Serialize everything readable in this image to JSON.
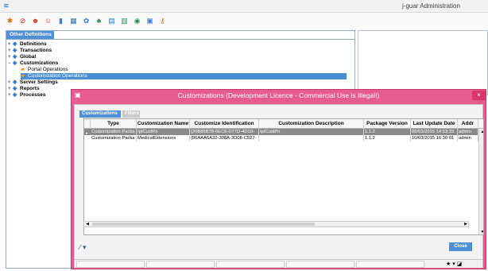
{
  "window": {
    "title": "j-guar Administration",
    "app_icon": "app-logo-icon"
  },
  "toolbar": {
    "buttons": [
      {
        "name": "refresh-icon",
        "glyph": "✱",
        "color": "#c87a10"
      },
      {
        "name": "stop-icon",
        "glyph": "⊘",
        "color": "#d21f1f"
      },
      {
        "name": "users-icon",
        "glyph": "☻",
        "color": "#d4401e"
      },
      {
        "name": "user-icon",
        "glyph": "☺",
        "color": "#d4401e"
      },
      {
        "name": "chart-icon",
        "glyph": "▮",
        "color": "#3a7bd5"
      },
      {
        "name": "calculator-icon",
        "glyph": "▦",
        "color": "#3a6fa0"
      },
      {
        "name": "settings-icon",
        "glyph": "✿",
        "color": "#3a7bd5"
      },
      {
        "name": "network-icon",
        "glyph": "♣",
        "color": "#2e8b57"
      },
      {
        "name": "id-card-icon",
        "glyph": "▤",
        "color": "#2a7cc4"
      },
      {
        "name": "reports-icon",
        "glyph": "▥",
        "color": "#2e8b57"
      },
      {
        "name": "database-icon",
        "glyph": "◉",
        "color": "#2e8b57"
      },
      {
        "name": "monitor-icon",
        "glyph": "▣",
        "color": "#3a7bd5"
      },
      {
        "name": "key-icon",
        "glyph": "⚷",
        "color": "#c87a10"
      }
    ]
  },
  "left_panel": {
    "tab_label": "Other Definitions",
    "tree": [
      {
        "label": "Definitions",
        "level": 0,
        "bold": true,
        "expander": "+"
      },
      {
        "label": "Transactions",
        "level": 0,
        "bold": true,
        "expander": "+"
      },
      {
        "label": "Global",
        "level": 0,
        "bold": true,
        "expander": "+"
      },
      {
        "label": "Customizations",
        "level": 0,
        "bold": true,
        "expander": "−"
      },
      {
        "label": "Portal Operations",
        "level": 1,
        "bold": false,
        "expander": ""
      },
      {
        "label": "Customization Operations",
        "level": 1,
        "bold": false,
        "expander": "",
        "selected": true
      },
      {
        "label": "Server Settings",
        "level": 0,
        "bold": true,
        "expander": "+"
      },
      {
        "label": "Reports",
        "level": 0,
        "bold": true,
        "expander": "+"
      },
      {
        "label": "Processes",
        "level": 0,
        "bold": true,
        "expander": "+"
      }
    ]
  },
  "dialog": {
    "title": "Customizations (Development Licence - Commercial Use is Illegal!)",
    "close_glyph": "×",
    "tabs": [
      {
        "label": "Customizations",
        "active": true
      },
      {
        "label": "Filters",
        "active": false
      }
    ],
    "columns": [
      "Type",
      "Customization Name",
      "Customize Identification",
      "Customization Description",
      "Package Version",
      "Last Update Date",
      "Addr"
    ],
    "rows": [
      {
        "selected": true,
        "cells": [
          "Customization Packa",
          "IptCustPri",
          "{20B85B78-6EC6-D77D-4D10-",
          "IptCustPri",
          "1.1.2",
          "06/03/2015 14:53:33",
          "admin"
        ]
      },
      {
        "selected": false,
        "cells": [
          "Customization Packa",
          "MedicalExtensions",
          "{86AAA6A32-308A-3D08-C527-",
          "",
          "1.1.2",
          "10/03/2015 16:30:01",
          "admin"
        ]
      }
    ],
    "close_button_label": "Close",
    "attach_glyph": "⁄ ▾",
    "status_icons": "★ ▾ ◪"
  }
}
